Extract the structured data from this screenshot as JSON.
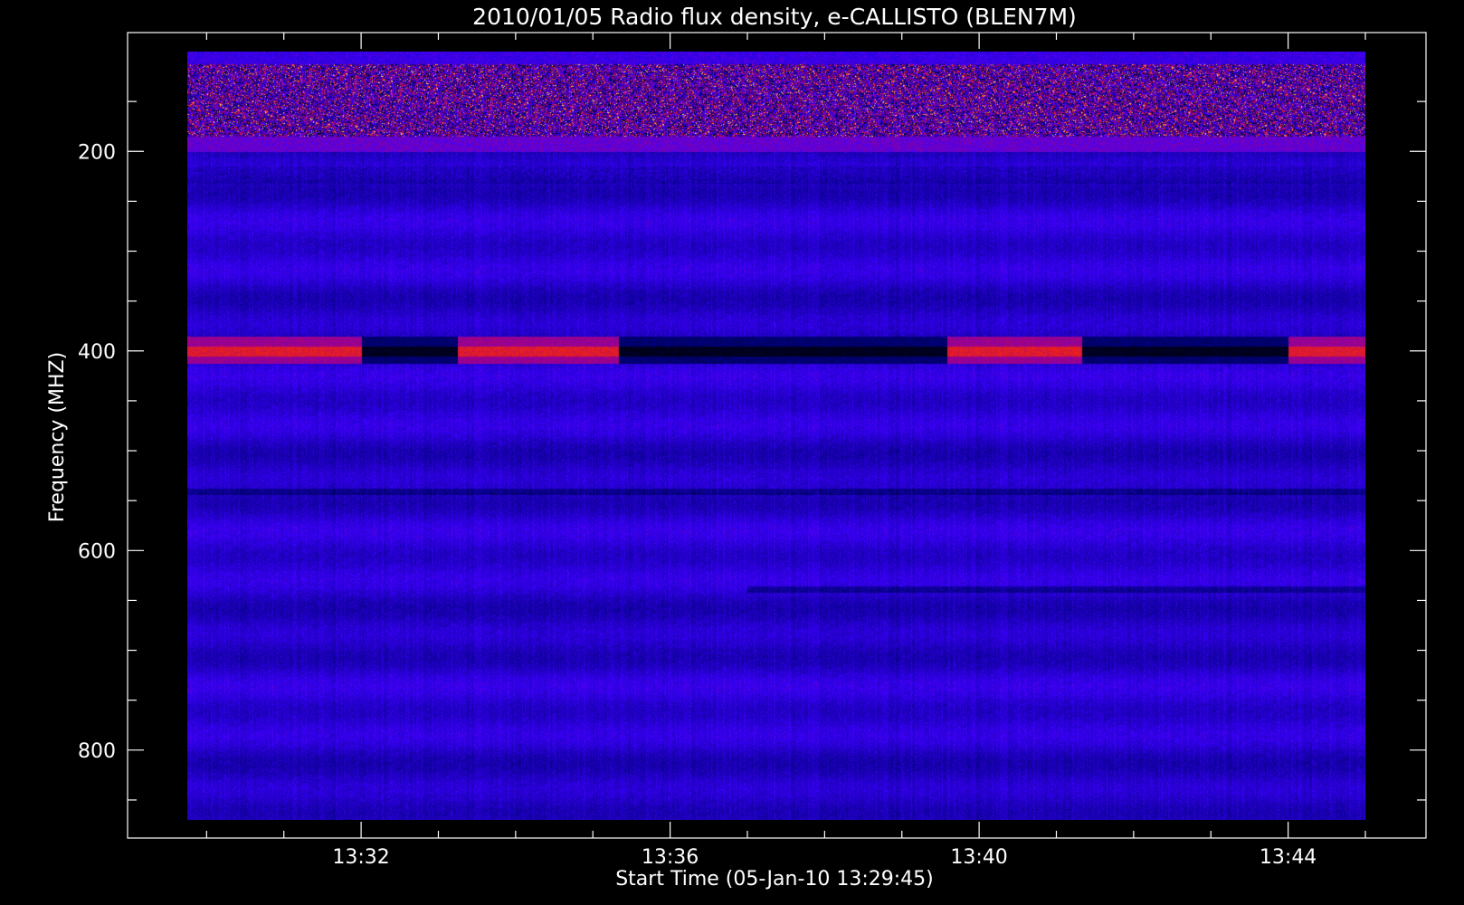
{
  "chart_data": {
    "type": "heatmap",
    "title": "2010/01/05  Radio flux density, e-CALLISTO (BLEN7M)",
    "xlabel": "Start Time (05-Jan-10 13:29:45)",
    "ylabel": "Frequency (MHZ)",
    "x_ticks": [
      "13:32",
      "13:36",
      "13:40",
      "13:44"
    ],
    "y_ticks": [
      "200",
      "400",
      "600",
      "800"
    ],
    "x_range_minutes": [
      "13:29:45",
      "13:45:00"
    ],
    "ylim": [
      870,
      100
    ],
    "y_axis_inverted": true,
    "colormap": "blue-red-yellow",
    "background": "#000000",
    "features": [
      {
        "kind": "rfi-band",
        "freq_mhz": [
          100,
          185
        ],
        "time": "full"
      },
      {
        "kind": "band",
        "freq_mhz": [
          390,
          410
        ],
        "time": [
          "13:29:45",
          "13:32:00"
        ],
        "level": "high"
      },
      {
        "kind": "band",
        "freq_mhz": [
          390,
          410
        ],
        "time": [
          "13:32:00",
          "13:33:15"
        ],
        "level": "low"
      },
      {
        "kind": "band",
        "freq_mhz": [
          390,
          410
        ],
        "time": [
          "13:33:15",
          "13:35:20"
        ],
        "level": "high"
      },
      {
        "kind": "band",
        "freq_mhz": [
          390,
          410
        ],
        "time": [
          "13:35:20",
          "13:39:35"
        ],
        "level": "low"
      },
      {
        "kind": "band",
        "freq_mhz": [
          390,
          410
        ],
        "time": [
          "13:39:35",
          "13:41:20"
        ],
        "level": "high"
      },
      {
        "kind": "band",
        "freq_mhz": [
          390,
          410
        ],
        "time": [
          "13:41:20",
          "13:44:00"
        ],
        "level": "low"
      },
      {
        "kind": "band",
        "freq_mhz": [
          390,
          410
        ],
        "time": [
          "13:44:00",
          "13:45:00"
        ],
        "level": "high"
      }
    ]
  }
}
